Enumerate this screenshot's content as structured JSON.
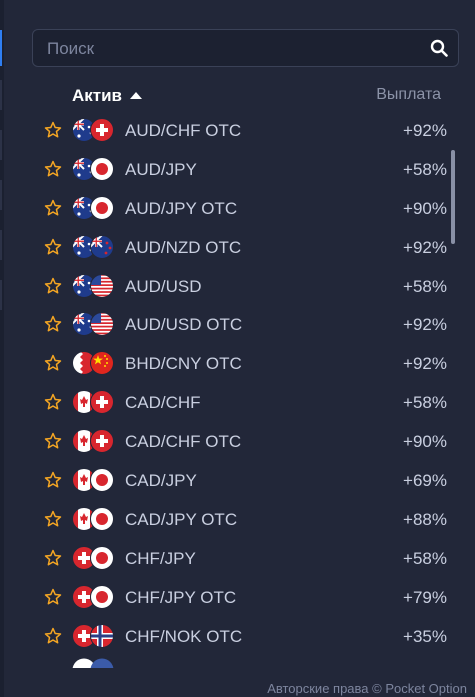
{
  "search": {
    "placeholder": "Поиск",
    "icon": "search-icon"
  },
  "columns": {
    "asset": "Актив",
    "payout": "Выплата"
  },
  "assets": [
    {
      "name": "AUD/CHF OTC",
      "payout": "+92%",
      "flags": [
        "au",
        "ch"
      ]
    },
    {
      "name": "AUD/JPY",
      "payout": "+58%",
      "flags": [
        "au",
        "jp"
      ]
    },
    {
      "name": "AUD/JPY OTC",
      "payout": "+90%",
      "flags": [
        "au",
        "jp"
      ]
    },
    {
      "name": "AUD/NZD OTC",
      "payout": "+92%",
      "flags": [
        "au",
        "nz"
      ]
    },
    {
      "name": "AUD/USD",
      "payout": "+58%",
      "flags": [
        "au",
        "us"
      ]
    },
    {
      "name": "AUD/USD OTC",
      "payout": "+92%",
      "flags": [
        "au",
        "us"
      ]
    },
    {
      "name": "BHD/CNY OTC",
      "payout": "+92%",
      "flags": [
        "bh",
        "cn"
      ]
    },
    {
      "name": "CAD/CHF",
      "payout": "+58%",
      "flags": [
        "ca",
        "ch"
      ]
    },
    {
      "name": "CAD/CHF OTC",
      "payout": "+90%",
      "flags": [
        "ca",
        "ch"
      ]
    },
    {
      "name": "CAD/JPY",
      "payout": "+69%",
      "flags": [
        "ca",
        "jp"
      ]
    },
    {
      "name": "CAD/JPY OTC",
      "payout": "+88%",
      "flags": [
        "ca",
        "jp"
      ]
    },
    {
      "name": "CHF/JPY",
      "payout": "+58%",
      "flags": [
        "ch",
        "jp"
      ]
    },
    {
      "name": "CHF/JPY OTC",
      "payout": "+79%",
      "flags": [
        "ch",
        "jp"
      ]
    },
    {
      "name": "CHF/NOK OTC",
      "payout": "+35%",
      "flags": [
        "ch",
        "no"
      ]
    }
  ],
  "footer": {
    "copyright": "Авторские права © Pocket Option"
  },
  "colors": {
    "background": "#222739",
    "star": "#f5a623",
    "accent": "#2f7ef2",
    "text": "#c9cfe0"
  }
}
